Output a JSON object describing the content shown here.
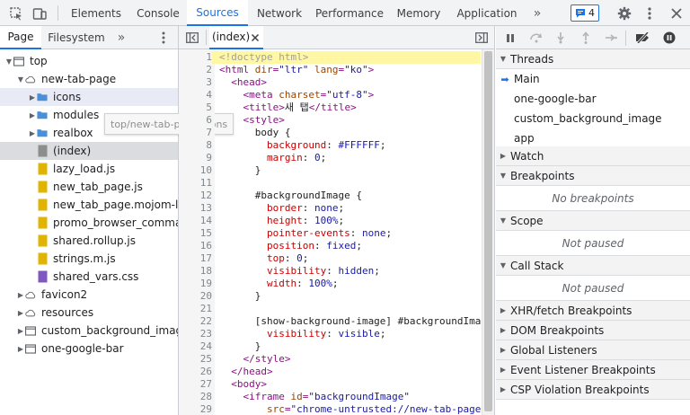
{
  "topbar": {
    "tabs": [
      "Elements",
      "Console",
      "Sources",
      "Network",
      "Performance",
      "Memory",
      "Application"
    ],
    "more_label": "»",
    "issues_count": "4"
  },
  "navigator": {
    "tabs": [
      "Page",
      "Filesystem"
    ],
    "more_label": "»",
    "tree": [
      {
        "label": "top",
        "depth": 0,
        "arrow": "down",
        "icon": "frame"
      },
      {
        "label": "new-tab-page",
        "depth": 1,
        "arrow": "down",
        "icon": "cloud"
      },
      {
        "label": "icons",
        "depth": 2,
        "arrow": "right",
        "icon": "folder",
        "state": "selected"
      },
      {
        "label": "modules",
        "depth": 2,
        "arrow": "right",
        "icon": "folder"
      },
      {
        "label": "realbox",
        "depth": 2,
        "arrow": "right",
        "icon": "folder"
      },
      {
        "label": "(index)",
        "depth": 2,
        "arrow": "",
        "icon": "doc-gray",
        "state": "highlight"
      },
      {
        "label": "lazy_load.js",
        "depth": 2,
        "arrow": "",
        "icon": "doc-yellow"
      },
      {
        "label": "new_tab_page.js",
        "depth": 2,
        "arrow": "",
        "icon": "doc-yellow"
      },
      {
        "label": "new_tab_page.mojom-lite.js",
        "depth": 2,
        "arrow": "",
        "icon": "doc-yellow"
      },
      {
        "label": "promo_browser_command.mojom-lite.js",
        "depth": 2,
        "arrow": "",
        "icon": "doc-yellow"
      },
      {
        "label": "shared.rollup.js",
        "depth": 2,
        "arrow": "",
        "icon": "doc-yellow"
      },
      {
        "label": "strings.m.js",
        "depth": 2,
        "arrow": "",
        "icon": "doc-yellow"
      },
      {
        "label": "shared_vars.css",
        "depth": 2,
        "arrow": "",
        "icon": "doc-purple"
      },
      {
        "label": "favicon2",
        "depth": 1,
        "arrow": "right",
        "icon": "cloud"
      },
      {
        "label": "resources",
        "depth": 1,
        "arrow": "right",
        "icon": "cloud"
      },
      {
        "label": "custom_background_image",
        "depth": 1,
        "arrow": "right",
        "icon": "frame"
      },
      {
        "label": "one-google-bar",
        "depth": 1,
        "arrow": "right",
        "icon": "frame"
      }
    ],
    "tooltip": "top/new-tab-page/icons"
  },
  "editor": {
    "tab_label": "(index)",
    "lines": [
      {
        "n": "1",
        "hl": true,
        "t": [
          [
            "cmt",
            "<!doctype html>"
          ]
        ]
      },
      {
        "n": "2",
        "t": [
          [
            "tag",
            "<html "
          ],
          [
            "attr",
            "dir"
          ],
          [
            "tag",
            "="
          ],
          [
            "val",
            "\"ltr\""
          ],
          [
            "tag",
            " "
          ],
          [
            "attr",
            "lang"
          ],
          [
            "tag",
            "="
          ],
          [
            "val",
            "\"ko\""
          ],
          [
            "tag",
            ">"
          ]
        ]
      },
      {
        "n": "3",
        "t": [
          [
            "text",
            "  "
          ],
          [
            "tag",
            "<head>"
          ]
        ]
      },
      {
        "n": "4",
        "t": [
          [
            "text",
            "    "
          ],
          [
            "tag",
            "<meta "
          ],
          [
            "attr",
            "charset"
          ],
          [
            "tag",
            "="
          ],
          [
            "val",
            "\"utf-8\""
          ],
          [
            "tag",
            ">"
          ]
        ]
      },
      {
        "n": "5",
        "t": [
          [
            "text",
            "    "
          ],
          [
            "tag",
            "<title>"
          ],
          [
            "text",
            "새 탭"
          ],
          [
            "tag",
            "</title>"
          ]
        ]
      },
      {
        "n": "6",
        "t": [
          [
            "text",
            "    "
          ],
          [
            "tag",
            "<style>"
          ]
        ]
      },
      {
        "n": "7",
        "t": [
          [
            "text",
            "      body {"
          ]
        ]
      },
      {
        "n": "8",
        "t": [
          [
            "text",
            "        "
          ],
          [
            "prop",
            "background"
          ],
          [
            "text",
            ": "
          ],
          [
            "val",
            "#FFFFFF"
          ],
          [
            "text",
            ";"
          ]
        ]
      },
      {
        "n": "9",
        "t": [
          [
            "text",
            "        "
          ],
          [
            "prop",
            "margin"
          ],
          [
            "text",
            ": "
          ],
          [
            "val",
            "0"
          ],
          [
            "text",
            ";"
          ]
        ]
      },
      {
        "n": "10",
        "t": [
          [
            "text",
            "      }"
          ]
        ]
      },
      {
        "n": "11",
        "t": []
      },
      {
        "n": "12",
        "t": [
          [
            "text",
            "      #backgroundImage {"
          ]
        ]
      },
      {
        "n": "13",
        "t": [
          [
            "text",
            "        "
          ],
          [
            "prop",
            "border"
          ],
          [
            "text",
            ": "
          ],
          [
            "val",
            "none"
          ],
          [
            "text",
            ";"
          ]
        ]
      },
      {
        "n": "14",
        "t": [
          [
            "text",
            "        "
          ],
          [
            "prop",
            "height"
          ],
          [
            "text",
            ": "
          ],
          [
            "val",
            "100%"
          ],
          [
            "text",
            ";"
          ]
        ]
      },
      {
        "n": "15",
        "t": [
          [
            "text",
            "        "
          ],
          [
            "prop",
            "pointer-events"
          ],
          [
            "text",
            ": "
          ],
          [
            "val",
            "none"
          ],
          [
            "text",
            ";"
          ]
        ]
      },
      {
        "n": "16",
        "t": [
          [
            "text",
            "        "
          ],
          [
            "prop",
            "position"
          ],
          [
            "text",
            ": "
          ],
          [
            "val",
            "fixed"
          ],
          [
            "text",
            ";"
          ]
        ]
      },
      {
        "n": "17",
        "t": [
          [
            "text",
            "        "
          ],
          [
            "prop",
            "top"
          ],
          [
            "text",
            ": "
          ],
          [
            "val",
            "0"
          ],
          [
            "text",
            ";"
          ]
        ]
      },
      {
        "n": "18",
        "t": [
          [
            "text",
            "        "
          ],
          [
            "prop",
            "visibility"
          ],
          [
            "text",
            ": "
          ],
          [
            "val",
            "hidden"
          ],
          [
            "text",
            ";"
          ]
        ]
      },
      {
        "n": "19",
        "t": [
          [
            "text",
            "        "
          ],
          [
            "prop",
            "width"
          ],
          [
            "text",
            ": "
          ],
          [
            "val",
            "100%"
          ],
          [
            "text",
            ";"
          ]
        ]
      },
      {
        "n": "20",
        "t": [
          [
            "text",
            "      }"
          ]
        ]
      },
      {
        "n": "21",
        "t": []
      },
      {
        "n": "22",
        "t": [
          [
            "text",
            "      [show-background-image] #backgroundImage {"
          ]
        ]
      },
      {
        "n": "23",
        "t": [
          [
            "text",
            "        "
          ],
          [
            "prop",
            "visibility"
          ],
          [
            "text",
            ": "
          ],
          [
            "val",
            "visible"
          ],
          [
            "text",
            ";"
          ]
        ]
      },
      {
        "n": "24",
        "t": [
          [
            "text",
            "      }"
          ]
        ]
      },
      {
        "n": "25",
        "t": [
          [
            "text",
            "    "
          ],
          [
            "tag",
            "</style>"
          ]
        ]
      },
      {
        "n": "26",
        "t": [
          [
            "text",
            "  "
          ],
          [
            "tag",
            "</head>"
          ]
        ]
      },
      {
        "n": "27",
        "t": [
          [
            "text",
            "  "
          ],
          [
            "tag",
            "<body>"
          ]
        ]
      },
      {
        "n": "28",
        "t": [
          [
            "text",
            "    "
          ],
          [
            "tag",
            "<iframe "
          ],
          [
            "attr",
            "id"
          ],
          [
            "tag",
            "="
          ],
          [
            "val",
            "\"backgroundImage\""
          ]
        ]
      },
      {
        "n": "29",
        "t": [
          [
            "text",
            "        "
          ],
          [
            "attr",
            "src"
          ],
          [
            "tag",
            "="
          ],
          [
            "val",
            "\"chrome-untrusted://new-tab-page/custom_background_image\""
          ]
        ]
      }
    ]
  },
  "debugger": {
    "threads_label": "Threads",
    "threads": [
      {
        "label": "Main",
        "current": true
      },
      {
        "label": "one-google-bar",
        "current": false
      },
      {
        "label": "custom_background_image",
        "current": false
      },
      {
        "label": "app",
        "current": false
      }
    ],
    "watch_label": "Watch",
    "breakpoints_label": "Breakpoints",
    "no_breakpoints": "No breakpoints",
    "scope_label": "Scope",
    "scope_note": "Not paused",
    "callstack_label": "Call Stack",
    "callstack_note": "Not paused",
    "more_sections": [
      "XHR/fetch Breakpoints",
      "DOM Breakpoints",
      "Global Listeners",
      "Event Listener Breakpoints",
      "CSP Violation Breakpoints"
    ]
  },
  "colors": {
    "accent": "#1a73e8",
    "folder": "#4a90d9",
    "doc_yellow": "#e0b400",
    "doc_purple": "#7f57c2",
    "doc_gray": "#8d8d8d"
  }
}
